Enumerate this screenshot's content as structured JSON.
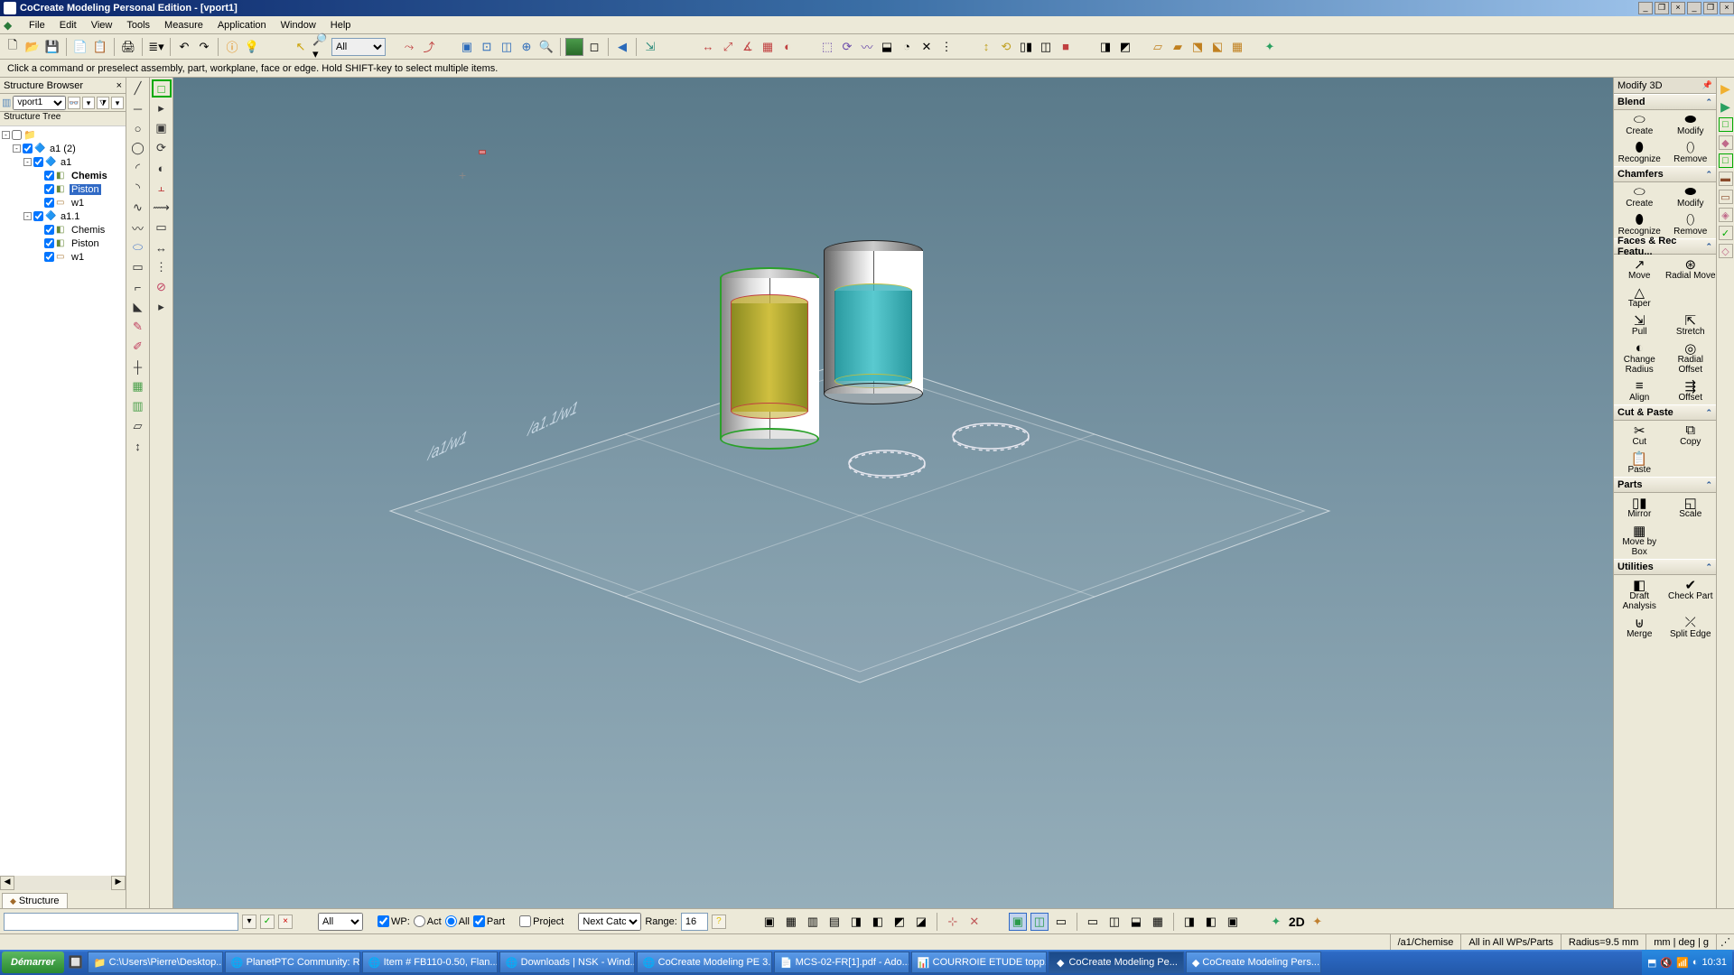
{
  "title": "CoCreate Modeling Personal Edition - [vport1]",
  "menubar": [
    "File",
    "Edit",
    "View",
    "Tools",
    "Measure",
    "Application",
    "Window",
    "Help"
  ],
  "hint": "Click a command or preselect assembly, part, workplane, face or edge. Hold SHIFT-key to select multiple items.",
  "toolbar_filter": "All",
  "structure": {
    "panel_title": "Structure Browser",
    "viewport_selector": "vport1",
    "tree_label": "Structure Tree",
    "tab": "Structure"
  },
  "tree": [
    {
      "indent": 0,
      "exp": "-",
      "check": false,
      "icon": "folder",
      "label": ""
    },
    {
      "indent": 1,
      "exp": "-",
      "check": true,
      "icon": "asm",
      "label": "a1 (2)"
    },
    {
      "indent": 2,
      "exp": "-",
      "check": true,
      "icon": "asm",
      "label": "a1"
    },
    {
      "indent": 3,
      "exp": "",
      "check": true,
      "icon": "part",
      "label": "Chemis",
      "bold": true
    },
    {
      "indent": 3,
      "exp": "",
      "check": true,
      "icon": "part",
      "label": "Piston",
      "selected": true
    },
    {
      "indent": 3,
      "exp": "",
      "check": true,
      "icon": "wp",
      "label": "w1"
    },
    {
      "indent": 2,
      "exp": "-",
      "check": true,
      "icon": "asm",
      "label": "a1.1"
    },
    {
      "indent": 3,
      "exp": "",
      "check": true,
      "icon": "part",
      "label": "Chemis"
    },
    {
      "indent": 3,
      "exp": "",
      "check": true,
      "icon": "part",
      "label": "Piston"
    },
    {
      "indent": 3,
      "exp": "",
      "check": true,
      "icon": "wp",
      "label": "w1"
    }
  ],
  "modify3d": {
    "title": "Modify 3D",
    "sections": [
      {
        "title": "Blend",
        "items": [
          "Create",
          "Modify",
          "Recognize",
          "Remove"
        ]
      },
      {
        "title": "Chamfers",
        "items": [
          "Create",
          "Modify",
          "Recognize",
          "Remove"
        ]
      },
      {
        "title": "Faces & Rec Featu...",
        "items": [
          "Move",
          "Radial Move",
          "Taper",
          "",
          "Pull",
          "Stretch",
          "Change Radius",
          "Radial Offset",
          "Align",
          "Offset"
        ]
      },
      {
        "title": "Cut & Paste",
        "items": [
          "Cut",
          "Copy",
          "Paste",
          ""
        ]
      },
      {
        "title": "Parts",
        "items": [
          "Mirror",
          "Scale",
          "Move by Box",
          ""
        ]
      },
      {
        "title": "Utilities",
        "items": [
          "Draft Analysis",
          "Check Part",
          "Merge",
          "Split Edge"
        ]
      }
    ]
  },
  "bottombar": {
    "filter": "All",
    "wp_label": "WP:",
    "act_label": "Act",
    "all_label": "All",
    "part_label": "Part",
    "project_label": "Project",
    "catch_selector": "Next Catch",
    "range_label": "Range:",
    "range_value": "16",
    "twod_label": "2D"
  },
  "statusbar": {
    "path": "/a1/Chemise",
    "scope": "All in All WPs/Parts",
    "radius": "Radius=9.5 mm",
    "units": "mm | deg | g"
  },
  "taskbar": {
    "start": "Démarrer",
    "items": [
      "C:\\Users\\Pierre\\Desktop...",
      "PlanetPTC Community: R...",
      "Item # FB110-0.50, Flan...",
      "Downloads | NSK - Wind...",
      "CoCreate Modeling PE 3...",
      "MCS-02-FR[1].pdf - Ado...",
      "COURROIE ETUDE  topp...",
      "CoCreate Modeling Pe...",
      "CoCreate Modeling Pers..."
    ],
    "active_index": 7,
    "time": "10:31"
  },
  "workplanes": {
    "wp1": "/a1.1/w1",
    "wp2": "/a1/w1"
  }
}
